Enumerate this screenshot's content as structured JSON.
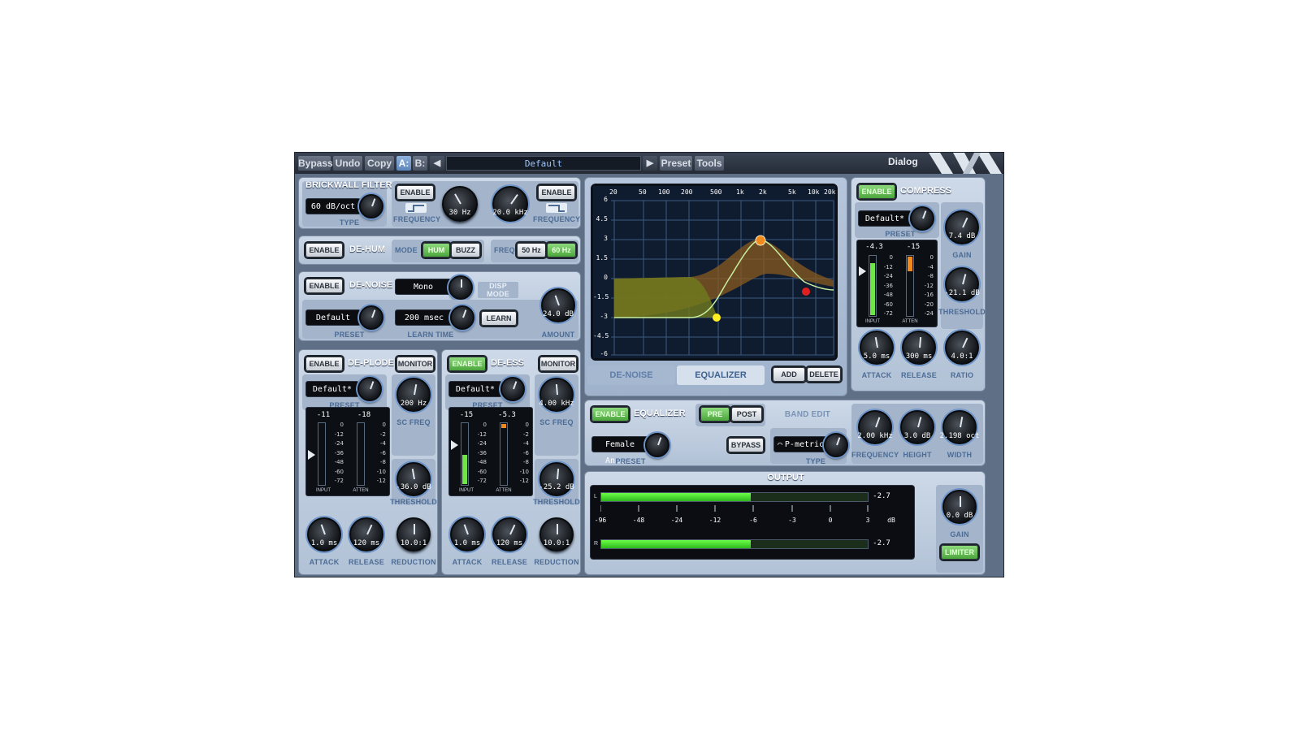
{
  "toolbar": {
    "bypass": "Bypass",
    "undo": "Undo",
    "copy": "Copy",
    "a": "A:",
    "b": "B:",
    "prev": "◀",
    "preset_name": "Default",
    "next": "▶",
    "preset": "Preset",
    "tools": "Tools",
    "dialog": "Dialog"
  },
  "brickwall": {
    "title": "BRICKWALL FILTER",
    "type_value": "60 dB/oct",
    "type_label": "TYPE",
    "enable_left": "ENABLE",
    "freq_label_left": "FREQUENCY",
    "hp_value": "30 Hz",
    "lp_value": "20.0 kHz",
    "enable_right": "ENABLE",
    "freq_label_right": "FREQUENCY"
  },
  "dehum": {
    "enable": "ENABLE",
    "title": "DE-HUM",
    "mode_label": "MODE",
    "hum": "HUM",
    "buzz": "BUZZ",
    "freq_label": "FREQ",
    "f50": "50 Hz",
    "f60": "60 Hz"
  },
  "denoise": {
    "enable": "ENABLE",
    "title": "DE-NOISE",
    "disp_value": "Mono",
    "disp_mode_label": "DISP MODE",
    "preset_value": "Default",
    "preset_label": "PRESET",
    "learn_value": "200 msec",
    "learn_time_label": "LEARN TIME",
    "learn_button": "LEARN",
    "amount_value": "24.0 dB",
    "amount_label": "AMOUNT"
  },
  "deplode": {
    "enable": "ENABLE",
    "title": "DE-PLODE",
    "monitor": "MONITOR",
    "preset_value": "Default*",
    "preset_label": "PRESET",
    "sc_value": "200 Hz",
    "sc_label": "SC FREQ",
    "input_peak": "-11",
    "atten_peak": "-18",
    "input_scale": [
      "0",
      "-12",
      "-24",
      "-36",
      "-48",
      "-60",
      "-72"
    ],
    "atten_scale": [
      "0",
      "-2",
      "-4",
      "-6",
      "-8",
      "-10",
      "-12"
    ],
    "input_label": "INPUT",
    "atten_label": "ATTEN",
    "threshold_value": "-36.0 dB",
    "threshold_label": "THRESHOLD",
    "attack_value": "1.0 ms",
    "attack_label": "ATTACK",
    "release_value": "120 ms",
    "release_label": "RELEASE",
    "reduction_value": "10.0:1",
    "reduction_label": "REDUCTION"
  },
  "deess": {
    "enable": "ENABLE",
    "title": "DE-ESS",
    "monitor": "MONITOR",
    "preset_value": "Default*",
    "preset_label": "PRESET",
    "sc_value": "4.00 kHz",
    "sc_label": "SC FREQ",
    "input_peak": "-15",
    "atten_peak": "-5.3",
    "input_scale": [
      "0",
      "-12",
      "-24",
      "-36",
      "-48",
      "-60",
      "-72"
    ],
    "atten_scale": [
      "0",
      "-2",
      "-4",
      "-6",
      "-8",
      "-10",
      "-12"
    ],
    "input_label": "INPUT",
    "atten_label": "ATTEN",
    "threshold_value": "-25.2 dB",
    "threshold_label": "THRESHOLD",
    "attack_value": "1.0 ms",
    "attack_label": "ATTACK",
    "release_value": "120 ms",
    "release_label": "RELEASE",
    "reduction_value": "10.0:1",
    "reduction_label": "REDUCTION"
  },
  "graph": {
    "freq_ticks": [
      "20",
      "50",
      "100",
      "200",
      "500",
      "1k",
      "2k",
      "5k",
      "10k",
      "20k"
    ],
    "db_ticks": [
      "6",
      "4.5",
      "3",
      "1.5",
      "0",
      "-1.5",
      "-3",
      "-4.5",
      "-6"
    ],
    "tab_denoise": "DE-NOISE",
    "tab_equalizer": "EQUALIZER",
    "add": "ADD",
    "delete": "DELETE"
  },
  "equalizer": {
    "enable": "ENABLE",
    "title": "EQUALIZER",
    "pre": "PRE",
    "post": "POST",
    "band_edit": "BAND EDIT",
    "preset_value": "Female Ann...",
    "preset_label": "PRESET",
    "bypass": "BYPASS",
    "type_value": "P-metric",
    "type_label": "TYPE",
    "frequency_value": "2.00 kHz",
    "frequency_label": "FREQUENCY",
    "height_value": "3.0 dB",
    "height_label": "HEIGHT",
    "width_value": "2.198 oct",
    "width_label": "WIDTH"
  },
  "compress": {
    "enable": "ENABLE",
    "title": "COMPRESS",
    "preset_value": "Default*",
    "preset_label": "PRESET",
    "input_peak": "-4.3",
    "atten_peak": "-15",
    "input_scale": [
      "0",
      "-12",
      "-24",
      "-36",
      "-48",
      "-60",
      "-72"
    ],
    "atten_scale": [
      "0",
      "-4",
      "-8",
      "-12",
      "-16",
      "-20",
      "-24"
    ],
    "input_label": "INPUT",
    "atten_label": "ATTEN",
    "gain_value": "7.4 dB",
    "gain_label": "GAIN",
    "threshold_value": "-21.1 dB",
    "threshold_label": "THRESHOLD",
    "attack_value": "5.0 ms",
    "attack_label": "ATTACK",
    "release_value": "300 ms",
    "release_label": "RELEASE",
    "ratio_value": "4.0:1",
    "ratio_label": "RATIO"
  },
  "output": {
    "title": "OUTPUT",
    "l": "L",
    "r": "R",
    "l_peak": "-2.7",
    "r_peak": "-2.7",
    "scale": [
      "-96",
      "-48",
      "-24",
      "-12",
      "-6",
      "-3",
      "0",
      "3"
    ],
    "db_label": "dB",
    "gain_value": "0.0 dB",
    "gain_label": "GAIN",
    "limiter": "LIMITER"
  },
  "colors": {
    "panel": "#c4d2e4",
    "accent_blue": "#4c6c96",
    "enable_green": "#5cb84a",
    "meter_green": "#7dff5a",
    "eq_band_orange": "#f08a1c",
    "eq_band_yellow": "#ffee22",
    "eq_band_red": "#e02020"
  }
}
